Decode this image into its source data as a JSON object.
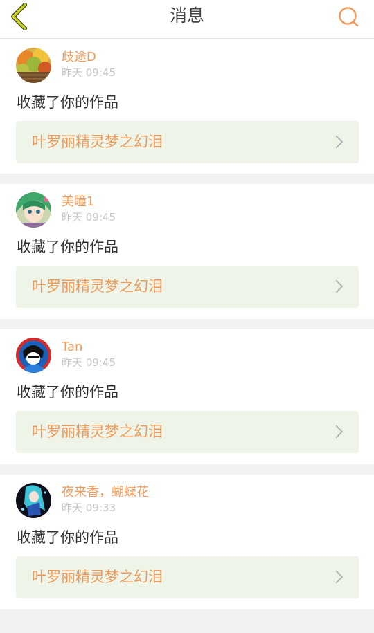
{
  "header": {
    "title": "消息",
    "back_icon": "chevron-left-icon",
    "search_icon": "search-icon"
  },
  "colors": {
    "accent": "#ef9a5a",
    "back_icon": "#c9d320",
    "link_bg": "#eef5e8",
    "timestamp": "#c6c6c6"
  },
  "messages": [
    {
      "username": "歧途D",
      "time": "昨天 09:45",
      "action": "收藏了你的作品",
      "work_title": "叶罗丽精灵梦之幻泪"
    },
    {
      "username": "美瞳1",
      "time": "昨天 09:45",
      "action": "收藏了你的作品",
      "work_title": "叶罗丽精灵梦之幻泪"
    },
    {
      "username": "Tan",
      "time": "昨天 09:45",
      "action": "收藏了你的作品",
      "work_title": "叶罗丽精灵梦之幻泪"
    },
    {
      "username": "夜来香，蝴蝶花",
      "time": "昨天 09:33",
      "action": "收藏了你的作品",
      "work_title": "叶罗丽精灵梦之幻泪"
    }
  ]
}
